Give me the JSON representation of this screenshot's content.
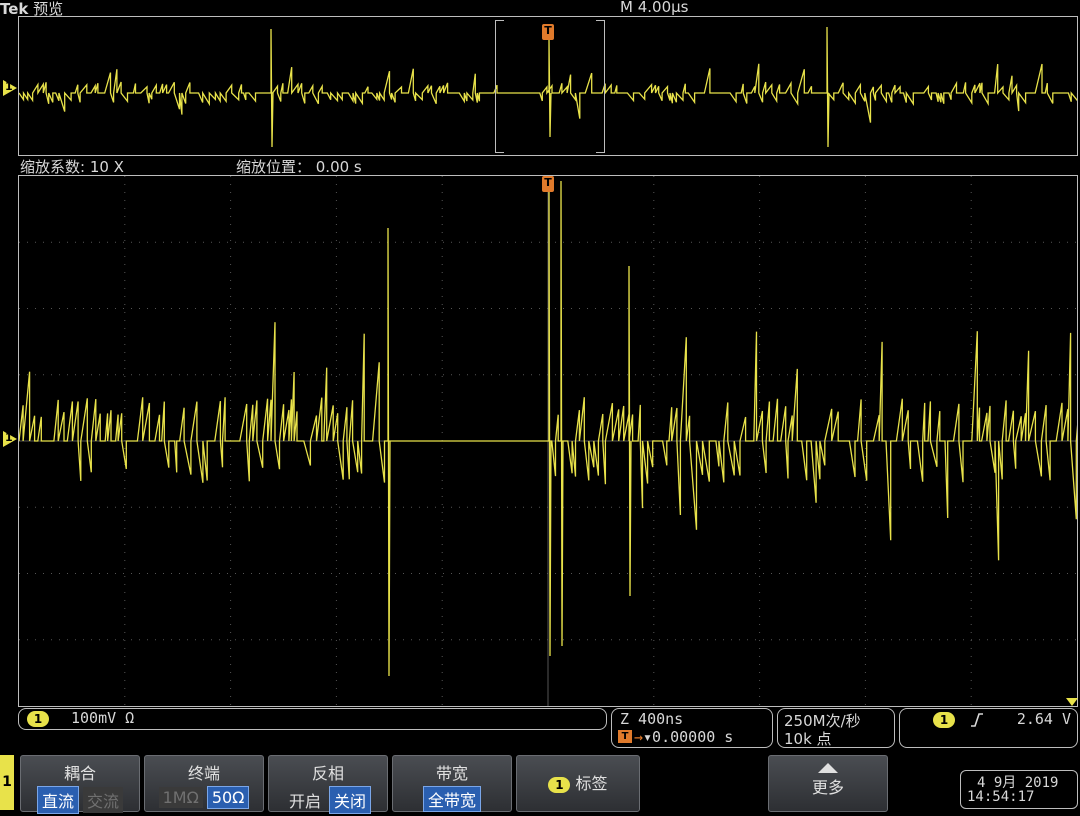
{
  "header": {
    "brand": "Tek",
    "mode": "预览",
    "timebase": "M 4.00µs"
  },
  "zoom": {
    "factor": "缩放系数: 10 X",
    "position": "缩放位置：  0.00 s"
  },
  "channel": {
    "marker": "1",
    "scale": "100mV Ω"
  },
  "horizontal": {
    "zoom_scale": "Z 400ns",
    "trigger_position": "▾0.00000 s"
  },
  "acquisition": {
    "rate": "250M次/秒",
    "record_length": "10k 点"
  },
  "trigger": {
    "source": "1",
    "slope": "rising-edge-icon",
    "level": "2.64 V"
  },
  "menu": {
    "side_marker": "1",
    "coupling": {
      "title": "耦合",
      "opt1": "直流",
      "opt2": "交流"
    },
    "termination": {
      "title": "终端",
      "opt1": "1MΩ",
      "opt2": "50Ω"
    },
    "invert": {
      "title": "反相",
      "opt1": "开启",
      "opt2": "关闭"
    },
    "bandwidth": {
      "title": "带宽",
      "opt1": "全带宽"
    },
    "label": {
      "chip": "1",
      "title": "标签"
    },
    "more": {
      "title": "更多"
    }
  },
  "datetime": {
    "date": "4 9月  2019",
    "time": "14:54:17"
  },
  "colors": {
    "trace": "#e8e24a",
    "trigger": "#e07a2b",
    "selected": "#2a5fb0"
  }
}
